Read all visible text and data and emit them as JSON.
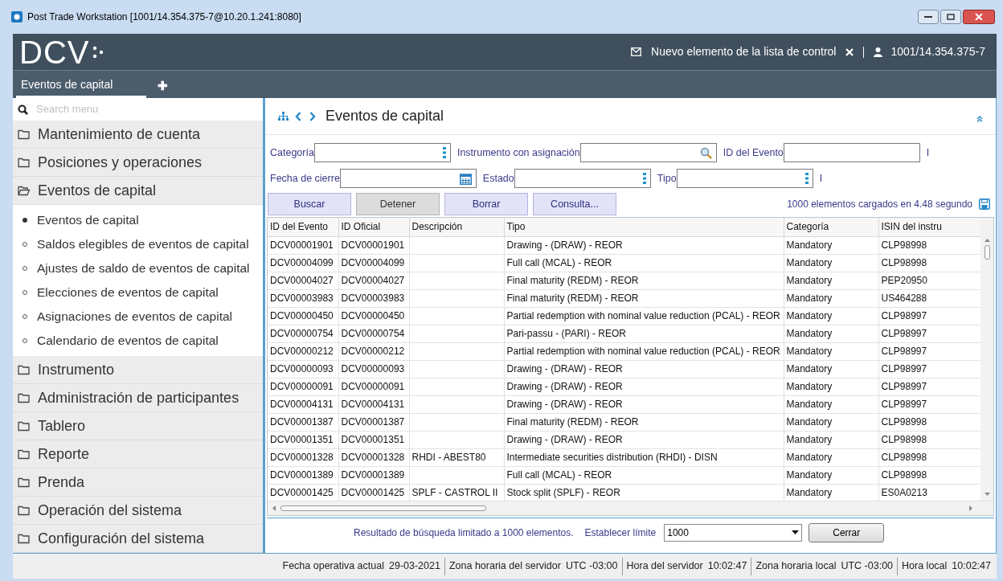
{
  "window": {
    "title": "Post Trade Workstation [1001/14.354.375-7@10.20.1.241:8080]"
  },
  "header": {
    "logo": "DCV",
    "notification": "Nuevo elemento de la lista de control",
    "user": "1001/14.354.375-7"
  },
  "tabs": [
    {
      "label": "Eventos de capital",
      "selected": true
    }
  ],
  "add_tab": "✚",
  "sidebar": {
    "search": {
      "placeholder": "Search menu"
    },
    "items": [
      {
        "label": "Mantenimiento de cuenta",
        "expanded": false
      },
      {
        "label": "Posiciones y operaciones",
        "expanded": false
      },
      {
        "label": "Eventos de capital",
        "expanded": true,
        "children": [
          {
            "label": "Eventos de capital",
            "selected": true
          },
          {
            "label": "Saldos elegibles de eventos de capital",
            "selected": false
          },
          {
            "label": "Ajustes de saldo de eventos de capital",
            "selected": false
          },
          {
            "label": "Elecciones de eventos de capital",
            "selected": false
          },
          {
            "label": "Asignaciones de eventos de capital",
            "selected": false
          },
          {
            "label": "Calendario de eventos de capital",
            "selected": false
          }
        ]
      },
      {
        "label": "Instrumento",
        "expanded": false
      },
      {
        "label": "Administración de participantes",
        "expanded": false
      },
      {
        "label": "Tablero",
        "expanded": false
      },
      {
        "label": "Reporte",
        "expanded": false
      },
      {
        "label": "Prenda",
        "expanded": false
      },
      {
        "label": "Operación del sistema",
        "expanded": false
      },
      {
        "label": "Configuración del sistema",
        "expanded": false
      }
    ]
  },
  "page": {
    "title": "Eventos de capital",
    "filters": [
      [
        {
          "label": "Categoría",
          "kind": "list"
        },
        {
          "label": "Instrumento con asignación",
          "kind": "search"
        },
        {
          "label": "ID del Evento",
          "kind": "text"
        },
        {
          "label": "I",
          "kind": "cut"
        }
      ],
      [
        {
          "label": "Fecha de cierre",
          "kind": "date"
        },
        {
          "label": "Estado",
          "kind": "list"
        },
        {
          "label": "Tipo",
          "kind": "list"
        },
        {
          "label": "I",
          "kind": "cut"
        }
      ]
    ],
    "buttons": [
      {
        "label": "Buscar",
        "disabled": false
      },
      {
        "label": "Detener",
        "disabled": true
      },
      {
        "label": "Borrar",
        "disabled": false
      },
      {
        "label": "Consulta...",
        "disabled": false
      }
    ],
    "load_info": "1000 elementos cargados en 4.48 segundo",
    "table": {
      "columns": [
        "ID del Evento",
        "ID Oficial",
        "Descripción",
        "Tipo",
        "Categoría",
        "ISIN del instru"
      ],
      "rows": [
        [
          "DCV00001901",
          "DCV00001901",
          "",
          "Drawing - (DRAW) - REOR",
          "Mandatory",
          "CLP98998"
        ],
        [
          "DCV00004099",
          "DCV00004099",
          "",
          "Full call (MCAL) - REOR",
          "Mandatory",
          "CLP98998"
        ],
        [
          "DCV00004027",
          "DCV00004027",
          "",
          "Final maturity (REDM) - REOR",
          "Mandatory",
          "PEP20950"
        ],
        [
          "DCV00003983",
          "DCV00003983",
          "",
          "Final maturity (REDM) - REOR",
          "Mandatory",
          "US464288"
        ],
        [
          "DCV00000450",
          "DCV00000450",
          "",
          "Partial redemption with nominal value reduction (PCAL) - REOR",
          "Mandatory",
          "CLP98997"
        ],
        [
          "DCV00000754",
          "DCV00000754",
          "",
          "Pari-passu - (PARI) - REOR",
          "Mandatory",
          "CLP98997"
        ],
        [
          "DCV00000212",
          "DCV00000212",
          "",
          "Partial redemption with nominal value reduction (PCAL) - REOR",
          "Mandatory",
          "CLP98997"
        ],
        [
          "DCV00000093",
          "DCV00000093",
          "",
          "Drawing - (DRAW) - REOR",
          "Mandatory",
          "CLP98997"
        ],
        [
          "DCV00000091",
          "DCV00000091",
          "",
          "Drawing - (DRAW) - REOR",
          "Mandatory",
          "CLP98997"
        ],
        [
          "DCV00004131",
          "DCV00004131",
          "",
          "Drawing - (DRAW) - REOR",
          "Mandatory",
          "CLP98997"
        ],
        [
          "DCV00001387",
          "DCV00001387",
          "",
          "Final maturity (REDM) - REOR",
          "Mandatory",
          "CLP98998"
        ],
        [
          "DCV00001351",
          "DCV00001351",
          "",
          "Drawing - (DRAW) - REOR",
          "Mandatory",
          "CLP98998"
        ],
        [
          "DCV00001328",
          "DCV00001328",
          "RHDI - ABEST80",
          "Intermediate securities distribution (RHDI) - DISN",
          "Mandatory",
          "CLP98998"
        ],
        [
          "DCV00001389",
          "DCV00001389",
          "",
          "Full call (MCAL) - REOR",
          "Mandatory",
          "CLP98998"
        ],
        [
          "DCV00001425",
          "DCV00001425",
          "SPLF - CASTROL II",
          "Stock split (SPLF) - REOR",
          "Mandatory",
          "ES0A0213"
        ]
      ]
    },
    "footer": {
      "limit_note": "Resultado de búsqueda limitado a 1000 elementos.",
      "limit_label": "Establecer límite",
      "limit_value": "1000",
      "close_button": "Cerrar"
    }
  },
  "status_bar": [
    {
      "label": "Fecha operativa actual",
      "value": "29-03-2021"
    },
    {
      "label": "Zona horaria del servidor",
      "value": "UTC -03:00"
    },
    {
      "label": "Hora del servidor",
      "value": "10:02:47"
    },
    {
      "label": "Zona horaria local",
      "value": "UTC -03:00"
    },
    {
      "label": "Hora local",
      "value": "10:02:47"
    }
  ]
}
